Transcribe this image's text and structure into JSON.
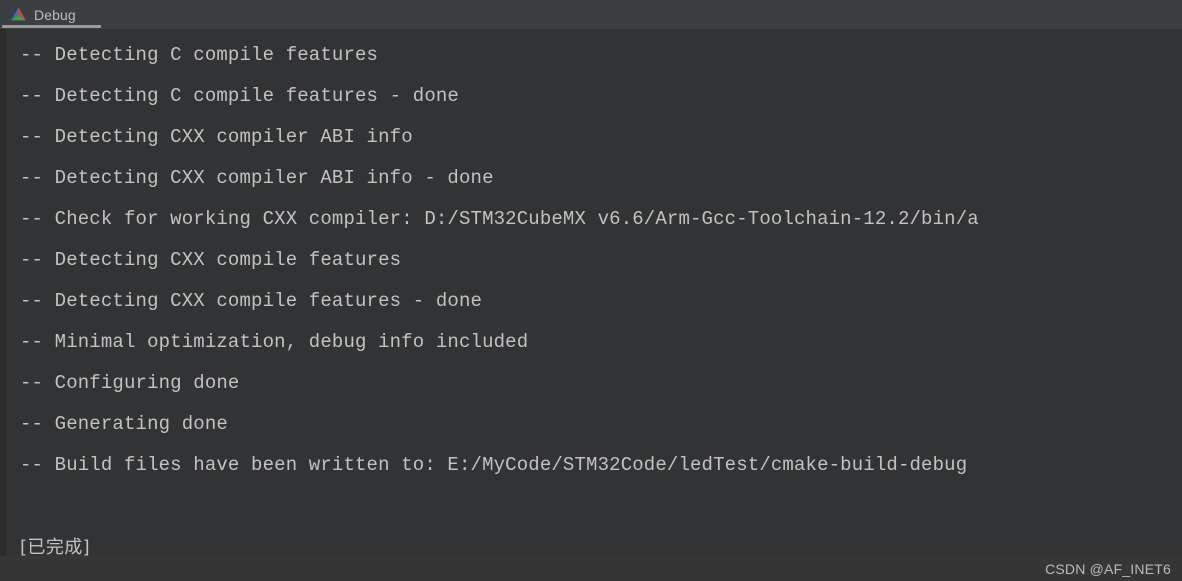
{
  "window": {
    "tab": {
      "label": "Debug",
      "icon": "clion-run-debug-triangle-icon",
      "active": true
    },
    "colors": {
      "tabbar_bg": "#3c3f41",
      "console_bg": "#313335",
      "gutter_bg": "#2b2b2b",
      "text": "#c2c2c2",
      "tab_underline": "#9a9a9a",
      "icon_blue": "#3b78c8",
      "icon_red": "#d1433b",
      "icon_green": "#3f9e3f"
    }
  },
  "console": {
    "lines": [
      "-- Detecting C compile features",
      "-- Detecting C compile features - done",
      "-- Detecting CXX compiler ABI info",
      "-- Detecting CXX compiler ABI info - done",
      "-- Check for working CXX compiler: D:/STM32CubeMX v6.6/Arm-Gcc-Toolchain-12.2/bin/a",
      "-- Detecting CXX compile features",
      "-- Detecting CXX compile features - done",
      "-- Minimal optimization, debug info included",
      "-- Configuring done",
      "-- Generating done",
      "-- Build files have been written to: E:/MyCode/STM32Code/ledTest/cmake-build-debug",
      "",
      "[已完成]"
    ]
  },
  "watermark": {
    "text": "CSDN @AF_INET6"
  }
}
